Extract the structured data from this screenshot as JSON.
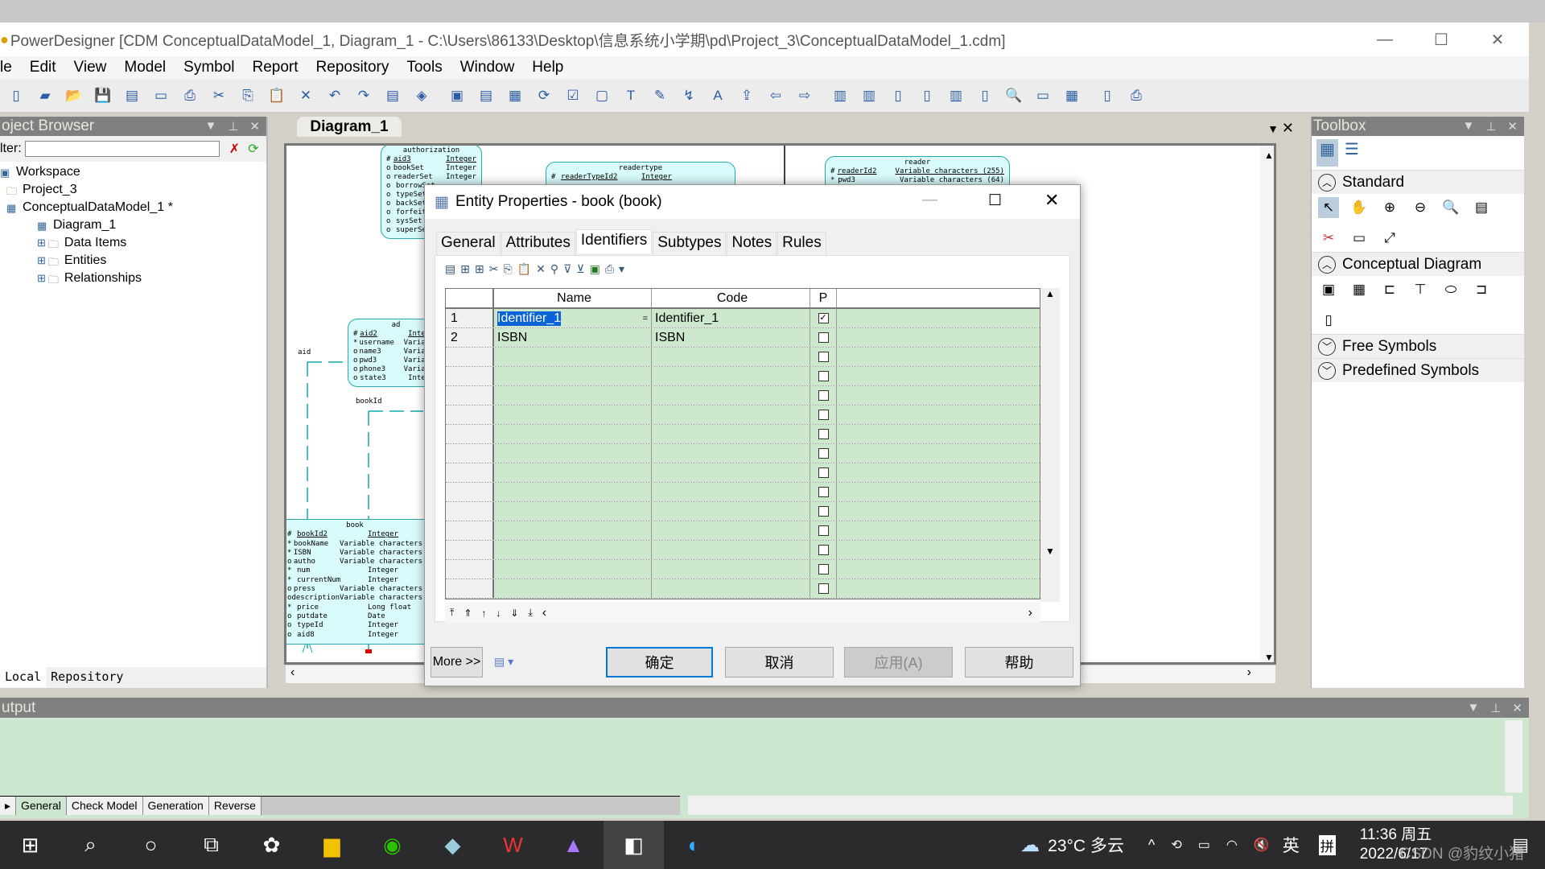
{
  "window": {
    "title": "PowerDesigner [CDM ConceptualDataModel_1, Diagram_1 - C:\\Users\\86133\\Desktop\\信息系统小学期\\pd\\Project_3\\ConceptualDataModel_1.cdm]"
  },
  "menu": [
    "le",
    "Edit",
    "View",
    "Model",
    "Symbol",
    "Report",
    "Repository",
    "Tools",
    "Window",
    "Help"
  ],
  "browser": {
    "title": "oject Browser",
    "filter_label": "lter:",
    "filter_value": "",
    "tree": [
      {
        "label": "Workspace",
        "level": 0
      },
      {
        "label": "Project_3",
        "level": 0
      },
      {
        "label": "ConceptualDataModel_1 *",
        "level": 0
      },
      {
        "label": "Diagram_1",
        "level": 1
      },
      {
        "label": "Data Items",
        "level": 1
      },
      {
        "label": "Entities",
        "level": 1
      },
      {
        "label": "Relationships",
        "level": 1
      }
    ],
    "tabs": [
      "Local",
      "Repository"
    ]
  },
  "diagram": {
    "tab": "Diagram_1",
    "labels": {
      "aid": "aid",
      "bookId": "bookId"
    },
    "entities": {
      "authorization": {
        "name": "authorization",
        "rows": [
          [
            "#",
            "aid3",
            "Integer"
          ],
          [
            "o",
            "bookSet",
            "Integer"
          ],
          [
            "o",
            "readerSet",
            "Integer"
          ],
          [
            "o",
            "borrowSet",
            ""
          ],
          [
            "o",
            "typeSet",
            ""
          ],
          [
            "o",
            "backSet",
            ""
          ],
          [
            "o",
            "forfeit",
            ""
          ],
          [
            "o",
            "sysSet",
            ""
          ],
          [
            "o",
            "superSet",
            ""
          ]
        ]
      },
      "readertype": {
        "name": "readertype",
        "rows": [
          [
            "#",
            "readerTypeId2",
            "Integer"
          ]
        ]
      },
      "reader": {
        "name": "reader",
        "rows": [
          [
            "#",
            "readerId2",
            "Variable characters (255)"
          ],
          [
            "*",
            "pwd3",
            "Variable characters (64)"
          ]
        ]
      },
      "admin": {
        "name": "ad",
        "rows": [
          [
            "#",
            "aid2",
            "Integer"
          ],
          [
            "*",
            "username",
            "Variable"
          ],
          [
            "o",
            "name3",
            "Variable"
          ],
          [
            "o",
            "pwd3",
            "Variable"
          ],
          [
            "o",
            "phone3",
            "Variable"
          ],
          [
            "o",
            "state3",
            "Integer"
          ]
        ]
      },
      "book": {
        "name": "book",
        "rows": [
          [
            "#",
            "bookId2",
            "Integer"
          ],
          [
            "*",
            "bookName",
            "Variable characters"
          ],
          [
            "*",
            "ISBN",
            "Variable characters"
          ],
          [
            "o",
            "autho",
            "Variable characters"
          ],
          [
            "*",
            "num",
            "Integer"
          ],
          [
            "*",
            "currentNum",
            "Integer"
          ],
          [
            "o",
            "press",
            "Variable characters"
          ],
          [
            "o",
            "description",
            "Variable characters"
          ],
          [
            "*",
            "price",
            "Long float"
          ],
          [
            "o",
            "putdate",
            "Date"
          ],
          [
            "o",
            "typeId",
            "Integer"
          ],
          [
            "o",
            "aid8",
            "Integer"
          ]
        ]
      }
    }
  },
  "toolbox": {
    "title": "Toolbox",
    "sections": [
      "Standard",
      "Conceptual Diagram",
      "Free Symbols",
      "Predefined Symbols"
    ]
  },
  "output": {
    "title": "utput",
    "tabs": [
      "General",
      "Check Model",
      "Generation",
      "Reverse"
    ]
  },
  "dialog": {
    "title": "Entity Properties - book (book)",
    "tabs": [
      "General",
      "Attributes",
      "Identifiers",
      "Subtypes",
      "Notes",
      "Rules"
    ],
    "active_tab": "Identifiers",
    "columns": [
      "Name",
      "Code",
      "P"
    ],
    "rows": [
      {
        "num": "1",
        "name": "Identifier_1",
        "code": "Identifier_1",
        "primary": true
      },
      {
        "num": "2",
        "name": "ISBN",
        "code": "ISBN",
        "primary": false
      }
    ],
    "empty_rows": 13,
    "buttons": {
      "more": "More >>",
      "ok": "确定",
      "cancel": "取消",
      "apply": "应用(A)",
      "help": "帮助"
    }
  },
  "taskbar": {
    "weather": "23°C 多云",
    "ime1": "英",
    "ime2": "拼",
    "time": "11:36 周五",
    "date": "2022/6/17",
    "watermark": "CSDN @豹纹小猪"
  },
  "colors": {
    "grid_bg": "#cde8cd",
    "entity_fill": "#d9fbfb",
    "entity_border": "#2aaaaa",
    "selection": "#0a64d8",
    "ok_border": "#0078d7"
  }
}
